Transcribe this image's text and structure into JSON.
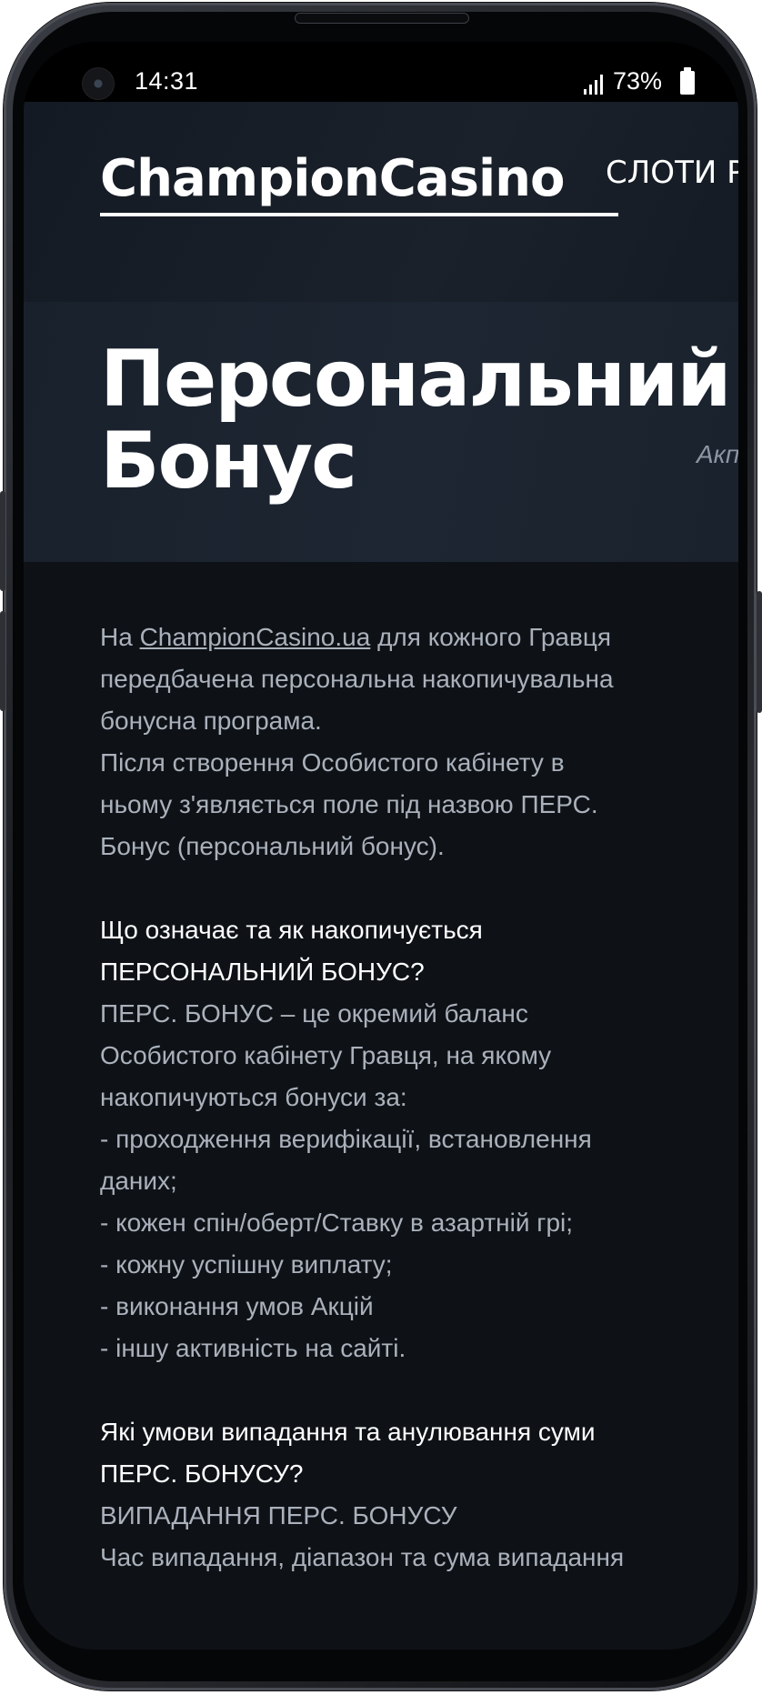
{
  "status_bar": {
    "time": "14:31",
    "battery_percent": "73%"
  },
  "header": {
    "logo_text_part1": "Champion",
    "logo_text_part2": "Casino",
    "nav_item": "СЛОТИ РУ"
  },
  "hero": {
    "title_line1": "Персональний",
    "title_line2": "Бонус",
    "side_tag": "Акп"
  },
  "article": {
    "intro_before_link": "На ",
    "intro_link": "ChampionCasino.ua",
    "intro_line1_after_link": " для кожного Гравця",
    "intro_line2": "передбачена персональна накопичувальна",
    "intro_line3": "бонусна програма.",
    "intro_line4": "Після створення Особистого кабінету в",
    "intro_line5": "ньому з'являється поле під назвою ПЕРС.",
    "intro_line6": "Бонус (персональний бонус).",
    "q1_line1": "Що означає та як накопичується",
    "q1_line2": "ПЕРСОНАЛЬНИЙ БОНУС?",
    "a1_line1": "ПЕРС. БОНУС – це окремий баланс",
    "a1_line2": "Особистого кабінету Гравця, на якому",
    "a1_line3": "накопичуються бонуси за:",
    "a1_line4": "- проходження верифікації, встановлення",
    "a1_line5": "даних;",
    "a1_line6": "- кожен спін/оберт/Ставку в азартній грі;",
    "a1_line7": "- кожну успішну виплату;",
    "a1_line8": "- виконання умов Акцій",
    "a1_line9": "- іншу активність на сайті.",
    "q2_line1": "Які умови випадання та анулювання суми",
    "q2_line2": "ПЕРС. БОНУСУ?",
    "a2_line1": "ВИПАДАННЯ ПЕРС. БОНУСУ",
    "a2_line2": "Час випадання, діапазон та сума випадання"
  }
}
